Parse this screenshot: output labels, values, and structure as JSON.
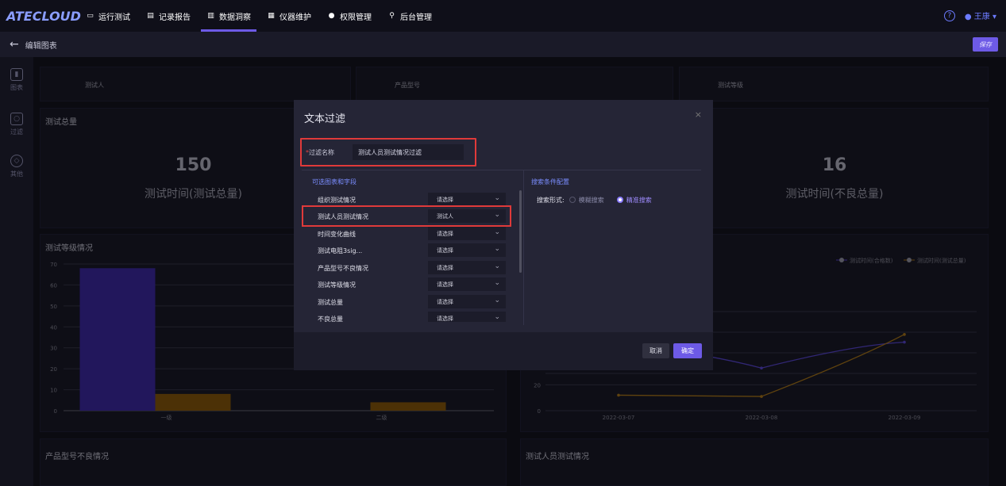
{
  "app": {
    "logo": "ATECLOUD"
  },
  "nav": [
    {
      "icon": "monitor-icon",
      "label": "运行测试"
    },
    {
      "icon": "clipboard-icon",
      "label": "记录报告"
    },
    {
      "icon": "insight-icon",
      "label": "数据洞察",
      "active": true
    },
    {
      "icon": "instrument-icon",
      "label": "仪器维护"
    },
    {
      "icon": "permission-icon",
      "label": "权限管理"
    },
    {
      "icon": "backend-icon",
      "label": "后台管理"
    }
  ],
  "user": {
    "help_icon": "?",
    "name": "王康"
  },
  "page": {
    "title": "编辑图表",
    "save": "保存"
  },
  "sidebar": [
    {
      "icon": "chart-icon",
      "label": "图表"
    },
    {
      "icon": "filter-icon",
      "label": "过滤"
    },
    {
      "icon": "cube-icon",
      "label": "其他"
    }
  ],
  "filters": [
    "测试人",
    "产品型号",
    "测试等级"
  ],
  "kpis": [
    {
      "title": "测试总量",
      "value": "150",
      "subtitle": "测试时间(测试总量)"
    },
    {
      "title": "",
      "value": "16",
      "subtitle": "测试时间(不良总量)"
    }
  ],
  "bar_panel": {
    "title": "测试等级情况"
  },
  "bottom_titles": [
    "产品型号不良情况",
    "测试人员测试情况"
  ],
  "chart_data": [
    {
      "type": "bar",
      "title": "测试等级情况",
      "categories": [
        "一级",
        "二级"
      ],
      "series": [
        {
          "values": [
            68,
            null
          ]
        },
        {
          "values": [
            8,
            4
          ]
        }
      ],
      "ylim": [
        0,
        70
      ],
      "yticks": [
        0,
        10,
        20,
        30,
        40,
        50,
        60,
        70
      ],
      "colors": [
        "#3f2ba8",
        "#8a5a0c"
      ]
    },
    {
      "type": "line",
      "x": [
        "2022-03-07",
        "2022-03-08",
        "2022-03-09"
      ],
      "series": [
        {
          "name": "测试时间(合格数)",
          "values": [
            null,
            33,
            53
          ]
        },
        {
          "name": "测试时间(测试总量)",
          "values": [
            12,
            11,
            59
          ]
        }
      ],
      "yticks": [
        0,
        20
      ],
      "colors": [
        "#5a47d6",
        "#b07a1a"
      ]
    }
  ],
  "modal": {
    "title": "文本过滤",
    "close": "×",
    "name_label": "过滤名称",
    "required_mark": "*",
    "name_value": "测试人员测试情况过滤",
    "fields_header": "可选图表和字段",
    "config_header": "搜索条件配置",
    "search_type_label": "搜索形式:",
    "option_fuzzy": "模糊搜索",
    "option_exact": "精准搜索",
    "fields": [
      {
        "name": "组织测试情况",
        "value": "请选择"
      },
      {
        "name": "测试人员测试情况",
        "value": "测试人"
      },
      {
        "name": "时间变化曲线",
        "value": "请选择"
      },
      {
        "name": "测试电阻3sig...",
        "value": "请选择"
      },
      {
        "name": "产品型号不良情况",
        "value": "请选择"
      },
      {
        "name": "测试等级情况",
        "value": "请选择"
      },
      {
        "name": "测试总量",
        "value": "请选择"
      },
      {
        "name": "不良总量",
        "value": "请选择"
      }
    ],
    "cancel": "取消",
    "ok": "确定"
  }
}
